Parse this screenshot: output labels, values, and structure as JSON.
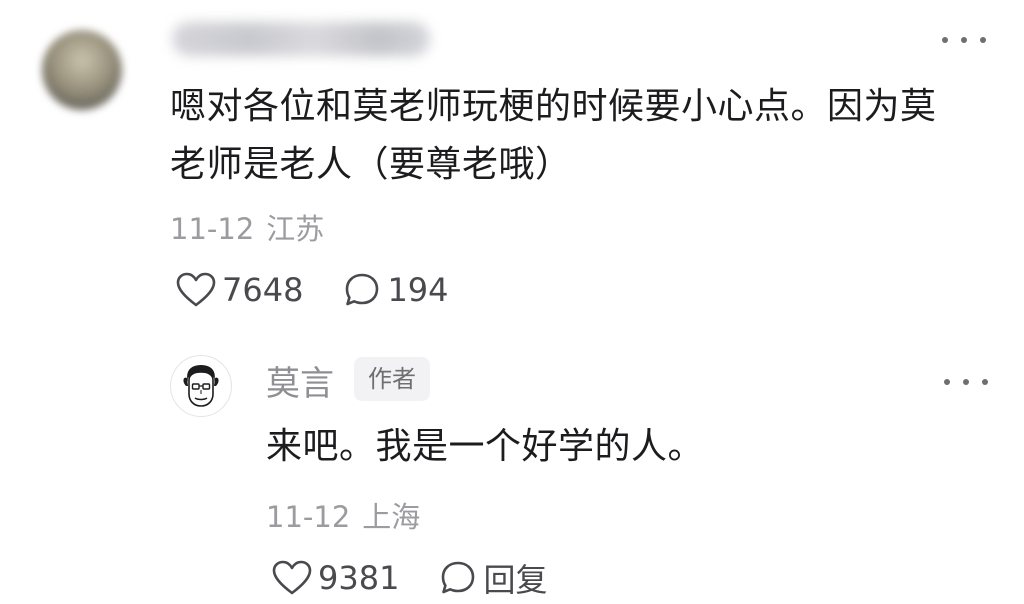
{
  "comment": {
    "username": "",
    "text": "嗯对各位和莫老师玩梗的时候要小心点。因为莫老师是老人（要尊老哦）",
    "date": "11-12",
    "location": "江苏",
    "likes": "7648",
    "replies": "194",
    "avatar_icon": "user-avatar-blurred",
    "like_icon": "heart-outline-icon",
    "reply_icon": "speech-bubble-icon"
  },
  "reply": {
    "username": "莫言",
    "badge": "作者",
    "text": "来吧。我是一个好学的人。",
    "date": "11-12",
    "location": "上海",
    "likes": "9381",
    "reply_label": "回复",
    "avatar_icon": "cartoon-portrait-avatar"
  },
  "colors": {
    "primary_text": "#1c1c1e",
    "secondary_text": "#9b9ba0",
    "icon": "#4a4a4e",
    "badge_bg": "#f2f2f4"
  }
}
